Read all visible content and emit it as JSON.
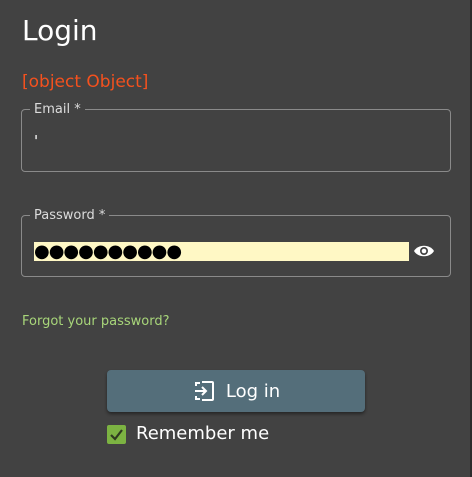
{
  "form": {
    "title": "Login",
    "error": "[object Object]",
    "email": {
      "label": "Email *",
      "value": "'"
    },
    "password": {
      "label": "Password *",
      "value": "●●●●●●●●●●"
    },
    "visibility_icon": "eye-icon",
    "forgot_link": "Forgot your password?",
    "login_button": {
      "label": "Log in",
      "icon": "login-icon"
    },
    "remember_me": {
      "label": "Remember me",
      "checked": true
    }
  },
  "colors": {
    "panel_bg": "#424242",
    "error": "#f4511e",
    "link": "#a8d67a",
    "button_bg": "#546e7a",
    "checkbox": "#7cb342",
    "autofill_bg": "#fff8c5"
  }
}
